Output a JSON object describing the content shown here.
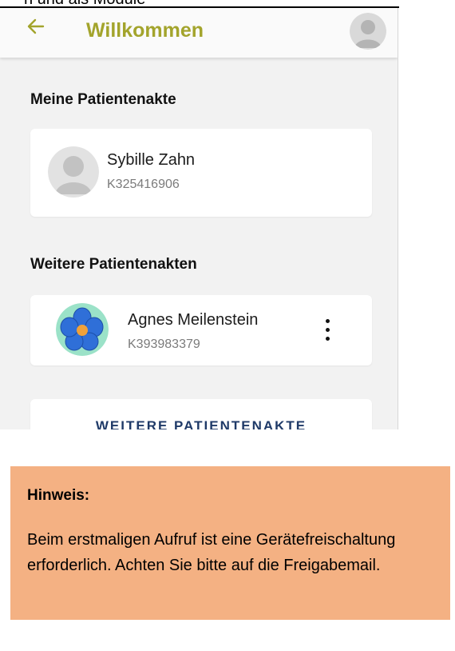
{
  "top_caption": "n und als Module",
  "app": {
    "title": "Willkommen",
    "back_icon": "arrow-left-icon",
    "avatar_icon": "user-avatar-icon",
    "accent_color": "#a3a42c"
  },
  "own_record": {
    "section_title": "Meine Patientenakte",
    "name": "Sybille Zahn",
    "id": "K325416906"
  },
  "other_records": {
    "section_title": "Weitere Patientenakten",
    "items": [
      {
        "name": "Agnes Meilenstein",
        "id": "K393983379",
        "avatar_icon": "flower-avatar-icon",
        "menu_icon": "more-vertical-icon"
      }
    ]
  },
  "add_button": {
    "label": "WEITERE PATIENTENAKTE"
  },
  "note": {
    "title": "Hinweis:",
    "text": "Beim erstmaligen Aufruf ist eine Gerätefreischaltung erforderlich. Achten Sie bitte auf die Freigabemail.",
    "background": "#f4b183"
  }
}
